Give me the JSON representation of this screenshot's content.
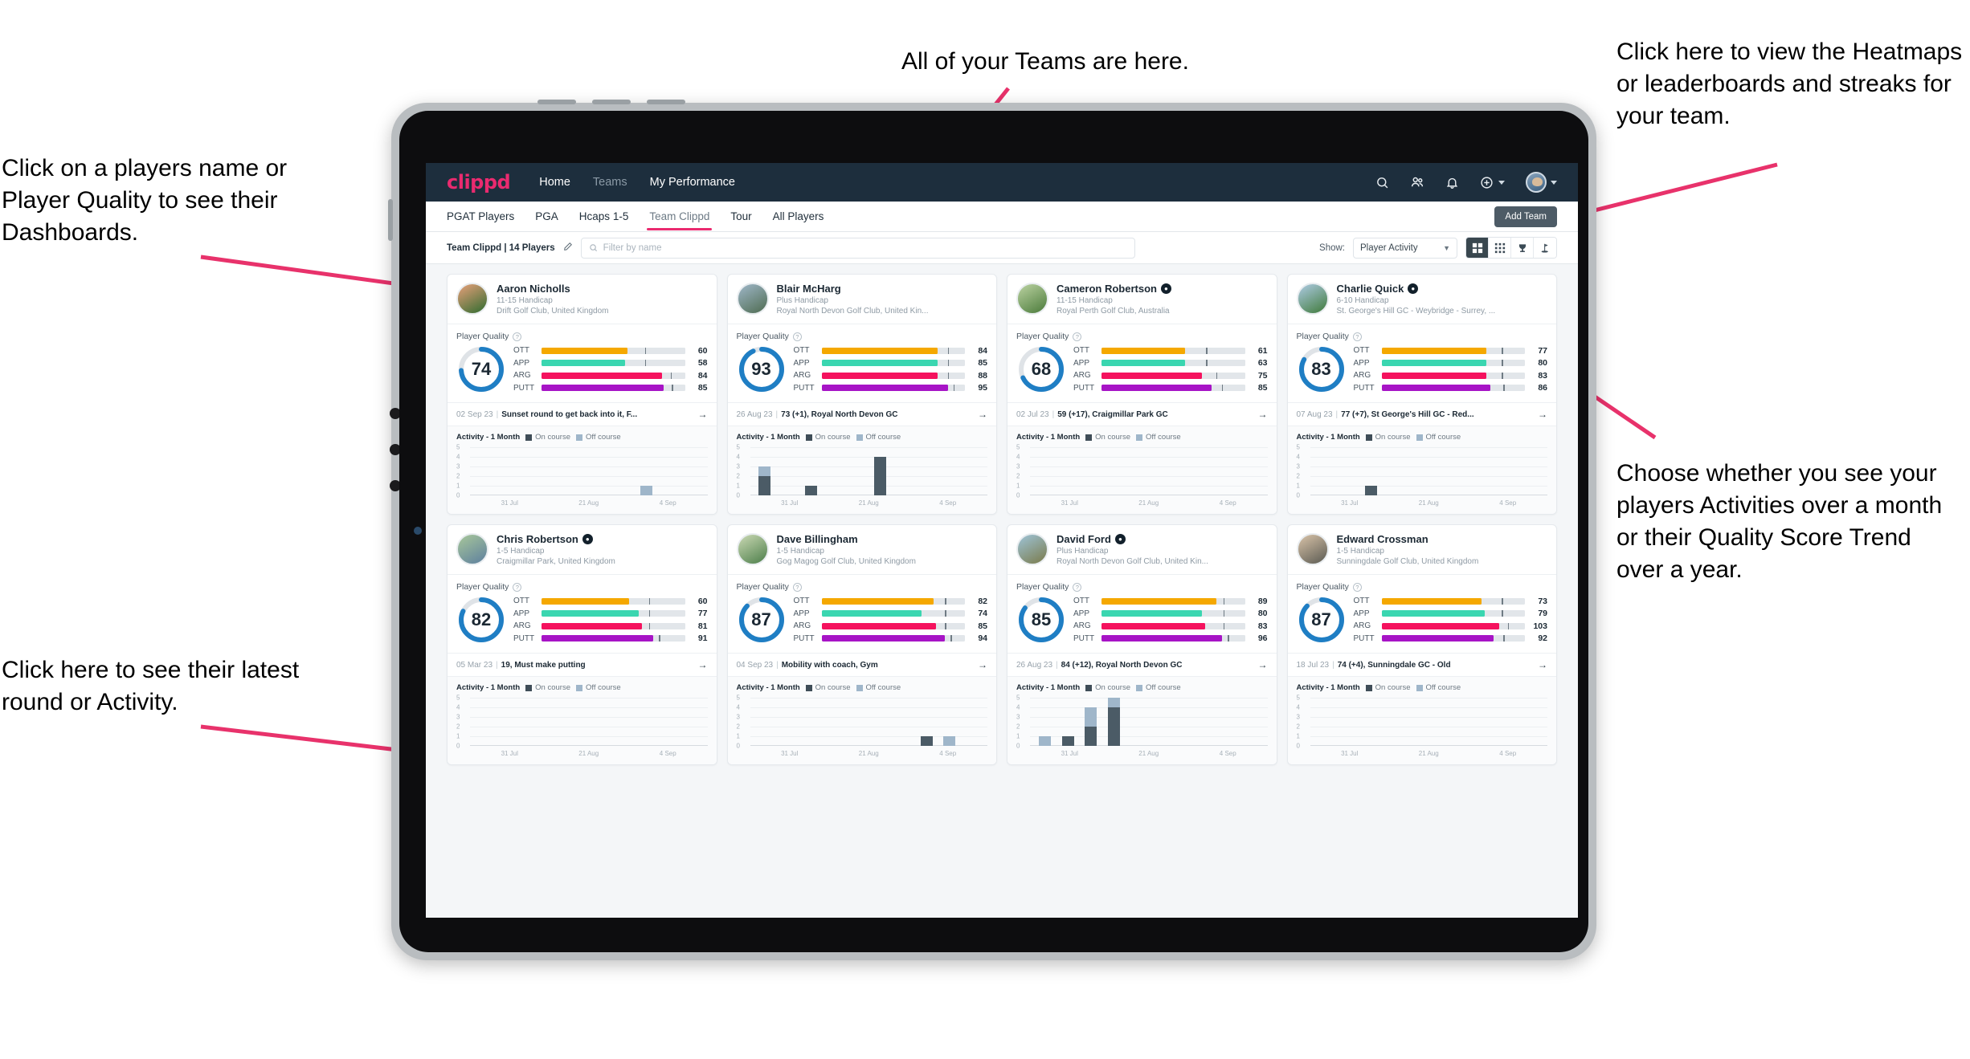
{
  "annotations": {
    "left_top": "Click on a players name or Player Quality to see their Dashboards.",
    "left_bottom": "Click here to see their latest round or Activity.",
    "top_middle": "All of your Teams are here.",
    "right_top": "Click here to view the Heatmaps or leaderboards and streaks for your team.",
    "right_bottom": "Choose whether you see your players Activities over a month or their Quality Score Trend over a year.",
    "arrow_color": "#e8326b"
  },
  "app": {
    "logo": "clippd",
    "nav_links": [
      {
        "label": "Home",
        "active": true
      },
      {
        "label": "Teams",
        "active": false
      },
      {
        "label": "My Performance",
        "active": true
      }
    ],
    "nav_icons": [
      "search-icon",
      "people-icon",
      "bell-icon",
      "plus-circle-icon",
      "avatar"
    ],
    "accent": "#ea2a6f",
    "nav_bg": "#1d2e3d"
  },
  "tabs": [
    {
      "label": "PGAT Players",
      "active": false,
      "muted": false
    },
    {
      "label": "PGA",
      "active": false,
      "muted": false
    },
    {
      "label": "Hcaps 1-5",
      "active": false,
      "muted": false
    },
    {
      "label": "Team Clippd",
      "active": true,
      "muted": false
    },
    {
      "label": "Tour",
      "active": false,
      "muted": false
    },
    {
      "label": "All Players",
      "active": false,
      "muted": false
    }
  ],
  "add_team_label": "Add Team",
  "toolbar": {
    "team_label": "Team Clippd | 14 Players",
    "edit_icon": "pencil-icon",
    "search_placeholder": "Filter by name",
    "show_label": "Show:",
    "show_value": "Player Activity",
    "view_buttons": [
      {
        "name": "grid-large-view",
        "active": true
      },
      {
        "name": "grid-small-view",
        "active": false
      },
      {
        "name": "leaderboard-trophy-view",
        "active": false
      },
      {
        "name": "heatmap-flag-view",
        "active": false
      }
    ]
  },
  "card_labels": {
    "player_quality": "Player Quality",
    "activity": "Activity - 1 Month",
    "legend_on": "On course",
    "legend_off": "Off course",
    "arrow": "→"
  },
  "metric_colors": {
    "OTT": "#f5a800",
    "APP": "#3ad6b0",
    "ARG": "#f5125e",
    "PUTT": "#a714c6",
    "ring": "#1f7ec4",
    "ring_track": "#dfe3e7"
  },
  "chart_defaults": {
    "y_ticks": [
      5,
      4,
      3,
      2,
      1,
      0
    ],
    "x_ticks": [
      "31 Jul",
      "21 Aug",
      "4 Sep"
    ],
    "ymax": 5,
    "slots": 10
  },
  "players": [
    {
      "name": "Aaron Nicholls",
      "verified": false,
      "handicap": "11-15 Handicap",
      "club": "Drift Golf Club, United Kingdom",
      "photo_from": "#e8a07a",
      "photo_to": "#2f6b2f",
      "quality": 74,
      "metrics": [
        {
          "label": "OTT",
          "value": 60,
          "fill": 60,
          "tick": 72
        },
        {
          "label": "APP",
          "value": 58,
          "fill": 58,
          "tick": 72
        },
        {
          "label": "ARG",
          "value": 84,
          "fill": 84,
          "tick": 90
        },
        {
          "label": "PUTT",
          "value": 85,
          "fill": 85,
          "tick": 91
        }
      ],
      "round": {
        "date": "02 Sep 23",
        "text": "Sunset round to get back into it, F..."
      },
      "chart_data": {
        "type": "bar",
        "title": "Activity - 1 Month",
        "categories": [
          "31 Jul",
          "",
          "",
          "",
          "",
          "21 Aug",
          "",
          "",
          "4 Sep",
          ""
        ],
        "series": [
          {
            "name": "On course",
            "values": [
              0,
              0,
              0,
              0,
              0,
              0,
              0,
              0,
              0,
              0
            ]
          },
          {
            "name": "Off course",
            "values": [
              0,
              0,
              0,
              0,
              0,
              0,
              0,
              1,
              0,
              0
            ]
          }
        ],
        "ylim": [
          0,
          5
        ],
        "xlabel": "",
        "ylabel": ""
      }
    },
    {
      "name": "Blair McHarg",
      "verified": false,
      "handicap": "Plus Handicap",
      "club": "Royal North Devon Golf Club, United Kin...",
      "photo_from": "#9fb7c9",
      "photo_to": "#4e6b50",
      "quality": 93,
      "metrics": [
        {
          "label": "OTT",
          "value": 84,
          "fill": 81,
          "tick": 88
        },
        {
          "label": "APP",
          "value": 85,
          "fill": 81,
          "tick": 88
        },
        {
          "label": "ARG",
          "value": 88,
          "fill": 81,
          "tick": 88
        },
        {
          "label": "PUTT",
          "value": 95,
          "fill": 88,
          "tick": 92
        }
      ],
      "round": {
        "date": "26 Aug 23",
        "text": "73 (+1), Royal North Devon GC"
      },
      "chart_data": {
        "type": "bar",
        "title": "Activity - 1 Month",
        "categories": [
          "31 Jul",
          "",
          "",
          "",
          "",
          "21 Aug",
          "",
          "",
          "4 Sep",
          ""
        ],
        "series": [
          {
            "name": "On course",
            "values": [
              2,
              0,
              1,
              0,
              0,
              4,
              0,
              0,
              0,
              0
            ]
          },
          {
            "name": "Off course",
            "values": [
              1,
              0,
              0,
              0,
              0,
              0,
              0,
              0,
              0,
              0
            ]
          }
        ],
        "ylim": [
          0,
          5
        ],
        "xlabel": "",
        "ylabel": ""
      }
    },
    {
      "name": "Cameron Robertson",
      "verified": true,
      "handicap": "11-15 Handicap",
      "club": "Royal Perth Golf Club, Australia",
      "photo_from": "#bcd3a2",
      "photo_to": "#4a7a3a",
      "quality": 68,
      "metrics": [
        {
          "label": "OTT",
          "value": 61,
          "fill": 58,
          "tick": 73
        },
        {
          "label": "APP",
          "value": 63,
          "fill": 58,
          "tick": 73
        },
        {
          "label": "ARG",
          "value": 75,
          "fill": 70,
          "tick": 80
        },
        {
          "label": "PUTT",
          "value": 85,
          "fill": 77,
          "tick": 84
        }
      ],
      "round": {
        "date": "02 Jul 23",
        "text": "59 (+17), Craigmillar Park GC"
      },
      "chart_data": {
        "type": "bar",
        "title": "Activity - 1 Month",
        "categories": [
          "31 Jul",
          "",
          "",
          "",
          "",
          "21 Aug",
          "",
          "",
          "4 Sep",
          ""
        ],
        "series": [
          {
            "name": "On course",
            "values": [
              0,
              0,
              0,
              0,
              0,
              0,
              0,
              0,
              0,
              0
            ]
          },
          {
            "name": "Off course",
            "values": [
              0,
              0,
              0,
              0,
              0,
              0,
              0,
              0,
              0,
              0
            ]
          }
        ],
        "ylim": [
          0,
          5
        ],
        "xlabel": "",
        "ylabel": ""
      }
    },
    {
      "name": "Charlie Quick",
      "verified": true,
      "handicap": "6-10 Handicap",
      "club": "St. George's Hill GC - Weybridge - Surrey, ...",
      "photo_from": "#aecbe4",
      "photo_to": "#3f7a3a",
      "quality": 83,
      "metrics": [
        {
          "label": "OTT",
          "value": 77,
          "fill": 73,
          "tick": 84
        },
        {
          "label": "APP",
          "value": 80,
          "fill": 73,
          "tick": 84
        },
        {
          "label": "ARG",
          "value": 83,
          "fill": 73,
          "tick": 84
        },
        {
          "label": "PUTT",
          "value": 86,
          "fill": 76,
          "tick": 85
        }
      ],
      "round": {
        "date": "07 Aug 23",
        "text": "77 (+7), St George's Hill GC - Red..."
      },
      "chart_data": {
        "type": "bar",
        "title": "Activity - 1 Month",
        "categories": [
          "31 Jul",
          "",
          "",
          "",
          "",
          "21 Aug",
          "",
          "",
          "4 Sep",
          ""
        ],
        "series": [
          {
            "name": "On course",
            "values": [
              0,
              0,
              1,
              0,
              0,
              0,
              0,
              0,
              0,
              0
            ]
          },
          {
            "name": "Off course",
            "values": [
              0,
              0,
              0,
              0,
              0,
              0,
              0,
              0,
              0,
              0
            ]
          }
        ],
        "ylim": [
          0,
          5
        ],
        "xlabel": "",
        "ylabel": ""
      }
    },
    {
      "name": "Chris Robertson",
      "verified": true,
      "handicap": "1-5 Handicap",
      "club": "Craigmillar Park, United Kingdom",
      "photo_from": "#a8c79a",
      "photo_to": "#5d7f9e",
      "quality": 82,
      "metrics": [
        {
          "label": "OTT",
          "value": 60,
          "fill": 61,
          "tick": 75
        },
        {
          "label": "APP",
          "value": 77,
          "fill": 68,
          "tick": 75
        },
        {
          "label": "ARG",
          "value": 81,
          "fill": 70,
          "tick": 75
        },
        {
          "label": "PUTT",
          "value": 91,
          "fill": 78,
          "tick": 82
        }
      ],
      "round": {
        "date": "05 Mar 23",
        "text": "19, Must make putting"
      },
      "chart_data": {
        "type": "bar",
        "title": "Activity - 1 Month",
        "categories": [
          "31 Jul",
          "",
          "",
          "",
          "",
          "21 Aug",
          "",
          "",
          "4 Sep",
          ""
        ],
        "series": [
          {
            "name": "On course",
            "values": [
              0,
              0,
              0,
              0,
              0,
              0,
              0,
              0,
              0,
              0
            ]
          },
          {
            "name": "Off course",
            "values": [
              0,
              0,
              0,
              0,
              0,
              0,
              0,
              0,
              0,
              0
            ]
          }
        ],
        "ylim": [
          0,
          5
        ],
        "xlabel": "",
        "ylabel": ""
      }
    },
    {
      "name": "Dave Billingham",
      "verified": false,
      "handicap": "1-5 Handicap",
      "club": "Gog Magog Golf Club, United Kingdom",
      "photo_from": "#cbd9b4",
      "photo_to": "#4c7e4a",
      "quality": 87,
      "metrics": [
        {
          "label": "OTT",
          "value": 82,
          "fill": 78,
          "tick": 86
        },
        {
          "label": "APP",
          "value": 74,
          "fill": 70,
          "tick": 86
        },
        {
          "label": "ARG",
          "value": 85,
          "fill": 80,
          "tick": 86
        },
        {
          "label": "PUTT",
          "value": 94,
          "fill": 86,
          "tick": 90
        }
      ],
      "round": {
        "date": "04 Sep 23",
        "text": "Mobility with coach, Gym"
      },
      "chart_data": {
        "type": "bar",
        "title": "Activity - 1 Month",
        "categories": [
          "31 Jul",
          "",
          "",
          "",
          "",
          "21 Aug",
          "",
          "",
          "4 Sep",
          ""
        ],
        "series": [
          {
            "name": "On course",
            "values": [
              0,
              0,
              0,
              0,
              0,
              0,
              0,
              1,
              0,
              0
            ]
          },
          {
            "name": "Off course",
            "values": [
              0,
              0,
              0,
              0,
              0,
              0,
              0,
              0,
              1,
              0
            ]
          }
        ],
        "ylim": [
          0,
          5
        ],
        "xlabel": "",
        "ylabel": ""
      }
    },
    {
      "name": "David Ford",
      "verified": true,
      "handicap": "Plus Handicap",
      "club": "Royal North Devon Golf Club, United Kin...",
      "photo_from": "#9ec4d8",
      "photo_to": "#7a7a4a",
      "quality": 85,
      "metrics": [
        {
          "label": "OTT",
          "value": 89,
          "fill": 80,
          "tick": 85
        },
        {
          "label": "APP",
          "value": 80,
          "fill": 70,
          "tick": 85
        },
        {
          "label": "ARG",
          "value": 83,
          "fill": 72,
          "tick": 85
        },
        {
          "label": "PUTT",
          "value": 96,
          "fill": 84,
          "tick": 88
        }
      ],
      "round": {
        "date": "26 Aug 23",
        "text": "84 (+12), Royal North Devon GC"
      },
      "chart_data": {
        "type": "bar",
        "title": "Activity - 1 Month",
        "categories": [
          "31 Jul",
          "",
          "",
          "",
          "",
          "21 Aug",
          "",
          "",
          "4 Sep",
          ""
        ],
        "series": [
          {
            "name": "On course",
            "values": [
              0,
              1,
              2,
              4,
              0,
              0,
              0,
              0,
              0,
              0
            ]
          },
          {
            "name": "Off course",
            "values": [
              1,
              0,
              2,
              1,
              0,
              0,
              0,
              0,
              0,
              0
            ]
          }
        ],
        "ylim": [
          0,
          5
        ],
        "xlabel": "",
        "ylabel": ""
      }
    },
    {
      "name": "Edward Crossman",
      "verified": false,
      "handicap": "1-5 Handicap",
      "club": "Sunningdale Golf Club, United Kingdom",
      "photo_from": "#d9c3a8",
      "photo_to": "#5a5a52",
      "quality": 87,
      "metrics": [
        {
          "label": "OTT",
          "value": 73,
          "fill": 70,
          "tick": 84
        },
        {
          "label": "APP",
          "value": 79,
          "fill": 72,
          "tick": 84
        },
        {
          "label": "ARG",
          "value": 103,
          "fill": 82,
          "tick": 88
        },
        {
          "label": "PUTT",
          "value": 92,
          "fill": 78,
          "tick": 85
        }
      ],
      "round": {
        "date": "18 Jul 23",
        "text": "74 (+4), Sunningdale GC - Old"
      },
      "chart_data": {
        "type": "bar",
        "title": "Activity - 1 Month",
        "categories": [
          "31 Jul",
          "",
          "",
          "",
          "",
          "21 Aug",
          "",
          "",
          "4 Sep",
          ""
        ],
        "series": [
          {
            "name": "On course",
            "values": [
              0,
              0,
              0,
              0,
              0,
              0,
              0,
              0,
              0,
              0
            ]
          },
          {
            "name": "Off course",
            "values": [
              0,
              0,
              0,
              0,
              0,
              0,
              0,
              0,
              0,
              0
            ]
          }
        ],
        "ylim": [
          0,
          5
        ],
        "xlabel": "",
        "ylabel": ""
      }
    }
  ]
}
